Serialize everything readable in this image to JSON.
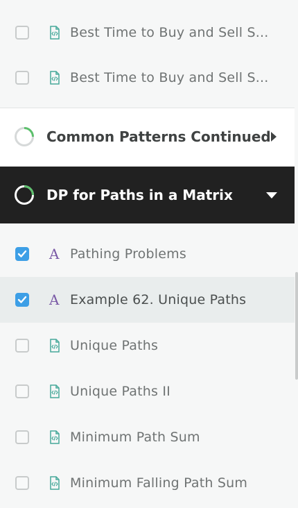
{
  "items_top": [
    {
      "label": "Best Time to Buy and Sell S...",
      "checked": false,
      "icon": "code-file-icon"
    },
    {
      "label": "Best Time to Buy and Sell S...",
      "checked": false,
      "icon": "code-file-icon"
    }
  ],
  "sections": [
    {
      "title": "Common Patterns Continued",
      "state": "collapsed",
      "progress": 0.3
    },
    {
      "title": "DP for Paths in a Matrix",
      "state": "expanded",
      "progress": 0.3
    }
  ],
  "items_bottom": [
    {
      "label": "Pathing Problems",
      "checked": true,
      "icon": "article-icon"
    },
    {
      "label": "Example 62. Unique Paths",
      "checked": true,
      "icon": "article-icon",
      "active": true
    },
    {
      "label": "Unique Paths",
      "checked": false,
      "icon": "code-file-icon"
    },
    {
      "label": "Unique Paths II",
      "checked": false,
      "icon": "code-file-icon"
    },
    {
      "label": "Minimum Path Sum",
      "checked": false,
      "icon": "code-file-icon"
    },
    {
      "label": "Minimum Falling Path Sum",
      "checked": false,
      "icon": "code-file-icon"
    }
  ],
  "colors": {
    "accent": "#3d9fe6",
    "progress": "#5cc06c",
    "dark_header": "#212121",
    "article_icon": "#7a5aa6",
    "code_icon": "#47a99a"
  }
}
